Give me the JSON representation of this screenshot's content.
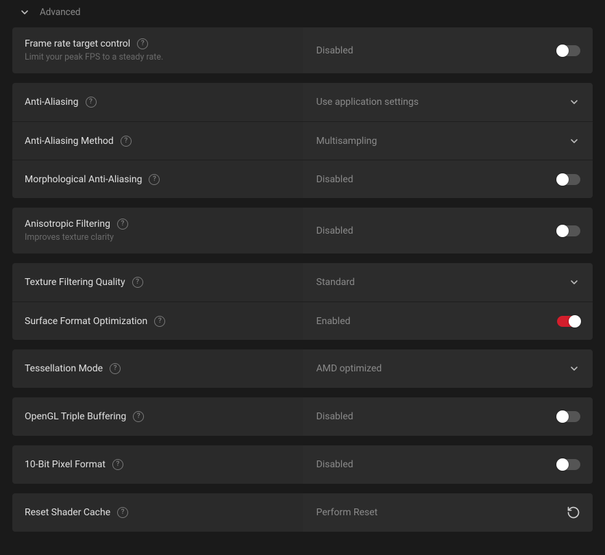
{
  "section": {
    "title": "Advanced"
  },
  "groups": [
    {
      "rows": [
        {
          "id": "frtc",
          "title": "Frame rate target control",
          "subtitle": "Limit your peak FPS to a steady rate.",
          "value": "Disabled",
          "control": "toggle",
          "on": false,
          "help": true
        }
      ]
    },
    {
      "rows": [
        {
          "id": "aa",
          "title": "Anti-Aliasing",
          "value": "Use application settings",
          "control": "dropdown",
          "help": true
        },
        {
          "id": "aa-method",
          "title": "Anti-Aliasing Method",
          "value": "Multisampling",
          "control": "dropdown",
          "help": true
        },
        {
          "id": "mlaa",
          "title": "Morphological Anti-Aliasing",
          "value": "Disabled",
          "control": "toggle",
          "on": false,
          "help": true
        }
      ]
    },
    {
      "rows": [
        {
          "id": "aniso",
          "title": "Anisotropic Filtering",
          "subtitle": "Improves texture clarity",
          "value": "Disabled",
          "control": "toggle",
          "on": false,
          "help": true
        }
      ]
    },
    {
      "rows": [
        {
          "id": "tfq",
          "title": "Texture Filtering Quality",
          "value": "Standard",
          "control": "dropdown",
          "help": true
        },
        {
          "id": "sfo",
          "title": "Surface Format Optimization",
          "value": "Enabled",
          "control": "toggle",
          "on": true,
          "help": true
        }
      ]
    },
    {
      "rows": [
        {
          "id": "tess",
          "title": "Tessellation Mode",
          "value": "AMD optimized",
          "control": "dropdown",
          "help": true
        }
      ]
    },
    {
      "rows": [
        {
          "id": "ogl-tb",
          "title": "OpenGL Triple Buffering",
          "value": "Disabled",
          "control": "toggle",
          "on": false,
          "help": true
        }
      ]
    },
    {
      "rows": [
        {
          "id": "10bit",
          "title": "10-Bit Pixel Format",
          "value": "Disabled",
          "control": "toggle",
          "on": false,
          "help": true
        }
      ]
    },
    {
      "rows": [
        {
          "id": "shader-reset",
          "title": "Reset Shader Cache",
          "value": "Perform Reset",
          "control": "action",
          "help": true
        }
      ]
    }
  ]
}
